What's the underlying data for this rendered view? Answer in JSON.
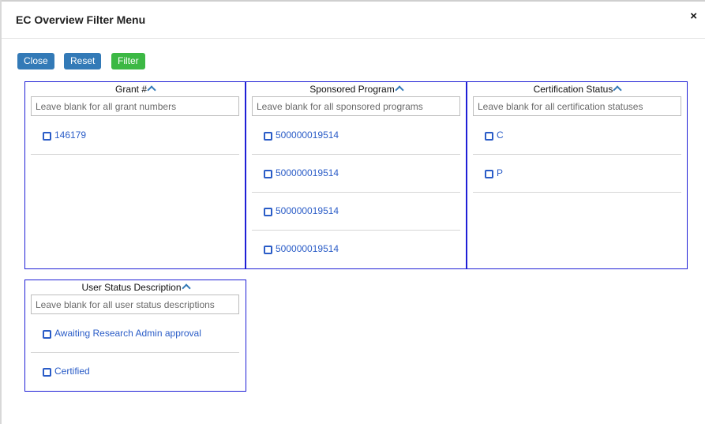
{
  "modal": {
    "title": "EC Overview Filter Menu",
    "close_glyph": "×"
  },
  "buttons": {
    "close": "Close",
    "reset": "Reset",
    "filter": "Filter"
  },
  "colors": {
    "primary_button": "#337ab7",
    "filter_button": "#3cb844",
    "panel_border": "#1f1fd6",
    "link_text": "#2a5cc7"
  },
  "panels": [
    {
      "title": "Grant #",
      "placeholder": "Leave blank for all grant numbers",
      "items": [
        "146179"
      ]
    },
    {
      "title": "Sponsored Program",
      "placeholder": "Leave blank for all sponsored programs",
      "items": [
        "500000019514",
        "500000019514",
        "500000019514",
        "500000019514"
      ]
    },
    {
      "title": "Certification Status",
      "placeholder": "Leave blank for all certification statuses",
      "items": [
        "C",
        "P"
      ]
    },
    {
      "title": "User Status Description",
      "placeholder": "Leave blank for all user status descriptions",
      "items": [
        "Awaiting Research Admin approval",
        "Certified"
      ]
    }
  ]
}
